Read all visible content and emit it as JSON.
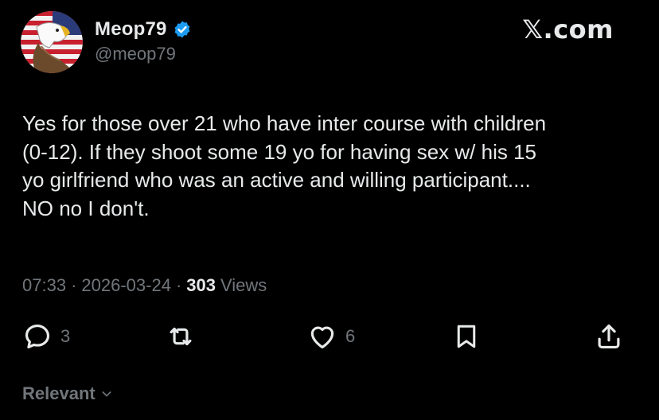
{
  "author": {
    "display_name": "Meop79",
    "handle": "@meop79",
    "verified": true,
    "avatar_icon": "eagle-flag-avatar"
  },
  "brand": "𝕏.com",
  "tweet": {
    "text": "Yes for those over 21 who have inter course with children\n(0-12).  If they shoot some 19 yo for having sex w/ his 15\nyo girlfriend who was an active and willing participant....\nNO no I don't."
  },
  "meta": {
    "time": "07:33",
    "date": "2026-03-24",
    "views_count": "303",
    "views_label": "Views",
    "separator": "·"
  },
  "actions": {
    "replies": "3",
    "likes": "6"
  },
  "sort": {
    "label": "Relevant"
  },
  "colors": {
    "background": "#000000",
    "text_primary": "#e7e9ea",
    "text_secondary": "#71767b",
    "verified_badge": "#1d9bf0"
  }
}
